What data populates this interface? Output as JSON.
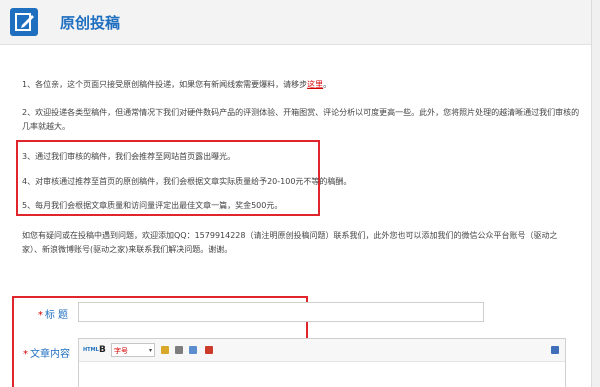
{
  "header": {
    "title": "原创投稿"
  },
  "notices": {
    "n1_prefix": "1、各位亲，这个页面只接受原创稿件投递，如果您有新闻线索需要爆料，请移步",
    "n1_link": "这里",
    "n1_suffix": "。",
    "n2": "2、欢迎投递各类型稿件，但通常情况下我们对硬件数码产品的评测体验、开箱图赏、评论分析以可度更高一些。此外，您将照片处理的越清晰通过我们审核的几率就越大。",
    "n3": "3、通过我们审核的稿件，我们会推荐至网站首页露出曝光。",
    "n4": "4、对审核通过推荐至首页的原创稿件，我们会根据文章实际质量给予20-100元不等的稿酬。",
    "n5": "5、每月我们会根据文章质量和访问量评定出最佳文章一篇，奖金500元。",
    "contact": "如您有疑问或在投稿中遇到问题，欢迎添加QQ：1579914228（请注明原创投稿问题）联系我们，此外您也可以添加我们的微信公众平台账号（驱动之家）、新浪微博账号(驱动之家)来联系我们解决问题。谢谢。"
  },
  "form": {
    "title_label": "标 题",
    "content_label": "文章内容",
    "star": "*",
    "title_value": ""
  },
  "toolbar": {
    "html": "HTML",
    "bold": "B",
    "font_size": "字号",
    "arrow": "▾"
  }
}
